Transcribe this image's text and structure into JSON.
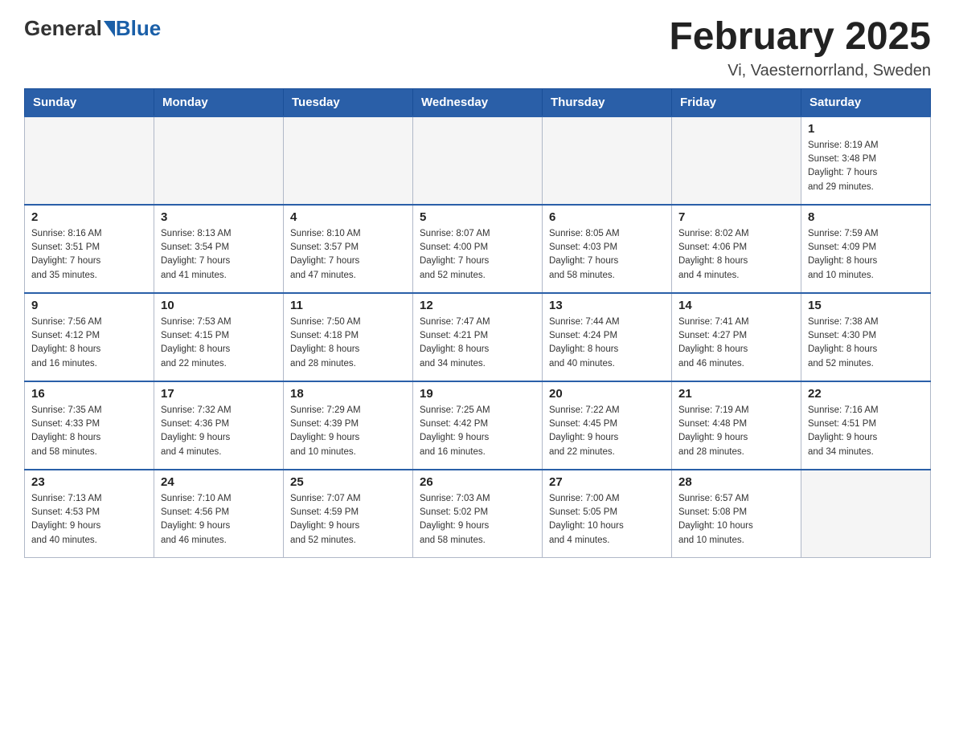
{
  "header": {
    "logo_general": "General",
    "logo_blue": "Blue",
    "month_title": "February 2025",
    "location": "Vi, Vaesternorrland, Sweden"
  },
  "weekdays": [
    "Sunday",
    "Monday",
    "Tuesday",
    "Wednesday",
    "Thursday",
    "Friday",
    "Saturday"
  ],
  "weeks": [
    [
      {
        "day": "",
        "info": ""
      },
      {
        "day": "",
        "info": ""
      },
      {
        "day": "",
        "info": ""
      },
      {
        "day": "",
        "info": ""
      },
      {
        "day": "",
        "info": ""
      },
      {
        "day": "",
        "info": ""
      },
      {
        "day": "1",
        "info": "Sunrise: 8:19 AM\nSunset: 3:48 PM\nDaylight: 7 hours\nand 29 minutes."
      }
    ],
    [
      {
        "day": "2",
        "info": "Sunrise: 8:16 AM\nSunset: 3:51 PM\nDaylight: 7 hours\nand 35 minutes."
      },
      {
        "day": "3",
        "info": "Sunrise: 8:13 AM\nSunset: 3:54 PM\nDaylight: 7 hours\nand 41 minutes."
      },
      {
        "day": "4",
        "info": "Sunrise: 8:10 AM\nSunset: 3:57 PM\nDaylight: 7 hours\nand 47 minutes."
      },
      {
        "day": "5",
        "info": "Sunrise: 8:07 AM\nSunset: 4:00 PM\nDaylight: 7 hours\nand 52 minutes."
      },
      {
        "day": "6",
        "info": "Sunrise: 8:05 AM\nSunset: 4:03 PM\nDaylight: 7 hours\nand 58 minutes."
      },
      {
        "day": "7",
        "info": "Sunrise: 8:02 AM\nSunset: 4:06 PM\nDaylight: 8 hours\nand 4 minutes."
      },
      {
        "day": "8",
        "info": "Sunrise: 7:59 AM\nSunset: 4:09 PM\nDaylight: 8 hours\nand 10 minutes."
      }
    ],
    [
      {
        "day": "9",
        "info": "Sunrise: 7:56 AM\nSunset: 4:12 PM\nDaylight: 8 hours\nand 16 minutes."
      },
      {
        "day": "10",
        "info": "Sunrise: 7:53 AM\nSunset: 4:15 PM\nDaylight: 8 hours\nand 22 minutes."
      },
      {
        "day": "11",
        "info": "Sunrise: 7:50 AM\nSunset: 4:18 PM\nDaylight: 8 hours\nand 28 minutes."
      },
      {
        "day": "12",
        "info": "Sunrise: 7:47 AM\nSunset: 4:21 PM\nDaylight: 8 hours\nand 34 minutes."
      },
      {
        "day": "13",
        "info": "Sunrise: 7:44 AM\nSunset: 4:24 PM\nDaylight: 8 hours\nand 40 minutes."
      },
      {
        "day": "14",
        "info": "Sunrise: 7:41 AM\nSunset: 4:27 PM\nDaylight: 8 hours\nand 46 minutes."
      },
      {
        "day": "15",
        "info": "Sunrise: 7:38 AM\nSunset: 4:30 PM\nDaylight: 8 hours\nand 52 minutes."
      }
    ],
    [
      {
        "day": "16",
        "info": "Sunrise: 7:35 AM\nSunset: 4:33 PM\nDaylight: 8 hours\nand 58 minutes."
      },
      {
        "day": "17",
        "info": "Sunrise: 7:32 AM\nSunset: 4:36 PM\nDaylight: 9 hours\nand 4 minutes."
      },
      {
        "day": "18",
        "info": "Sunrise: 7:29 AM\nSunset: 4:39 PM\nDaylight: 9 hours\nand 10 minutes."
      },
      {
        "day": "19",
        "info": "Sunrise: 7:25 AM\nSunset: 4:42 PM\nDaylight: 9 hours\nand 16 minutes."
      },
      {
        "day": "20",
        "info": "Sunrise: 7:22 AM\nSunset: 4:45 PM\nDaylight: 9 hours\nand 22 minutes."
      },
      {
        "day": "21",
        "info": "Sunrise: 7:19 AM\nSunset: 4:48 PM\nDaylight: 9 hours\nand 28 minutes."
      },
      {
        "day": "22",
        "info": "Sunrise: 7:16 AM\nSunset: 4:51 PM\nDaylight: 9 hours\nand 34 minutes."
      }
    ],
    [
      {
        "day": "23",
        "info": "Sunrise: 7:13 AM\nSunset: 4:53 PM\nDaylight: 9 hours\nand 40 minutes."
      },
      {
        "day": "24",
        "info": "Sunrise: 7:10 AM\nSunset: 4:56 PM\nDaylight: 9 hours\nand 46 minutes."
      },
      {
        "day": "25",
        "info": "Sunrise: 7:07 AM\nSunset: 4:59 PM\nDaylight: 9 hours\nand 52 minutes."
      },
      {
        "day": "26",
        "info": "Sunrise: 7:03 AM\nSunset: 5:02 PM\nDaylight: 9 hours\nand 58 minutes."
      },
      {
        "day": "27",
        "info": "Sunrise: 7:00 AM\nSunset: 5:05 PM\nDaylight: 10 hours\nand 4 minutes."
      },
      {
        "day": "28",
        "info": "Sunrise: 6:57 AM\nSunset: 5:08 PM\nDaylight: 10 hours\nand 10 minutes."
      },
      {
        "day": "",
        "info": ""
      }
    ]
  ]
}
